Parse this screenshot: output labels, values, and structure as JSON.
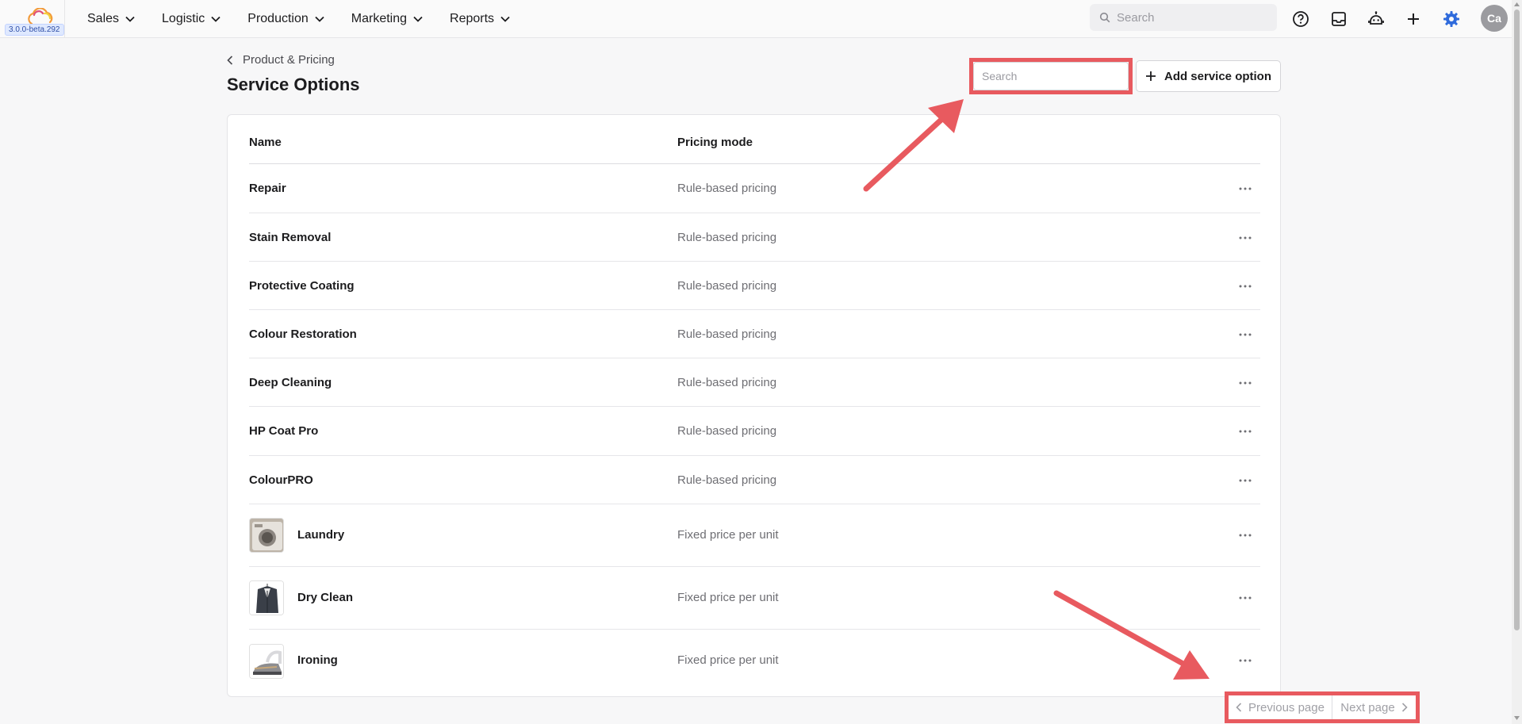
{
  "app": {
    "version": "3.0.0-beta.292",
    "accent_color": "#2f6bdc",
    "annotation_color": "#e85a5f"
  },
  "nav": {
    "items": [
      {
        "label": "Sales"
      },
      {
        "label": "Logistic"
      },
      {
        "label": "Production"
      },
      {
        "label": "Marketing"
      },
      {
        "label": "Reports"
      }
    ]
  },
  "topbar": {
    "search_placeholder": "Search",
    "avatar_initials": "Ca",
    "icons": [
      "help-icon",
      "inbox-icon",
      "assistant-bot-icon",
      "plus-icon",
      "settings-gear-icon"
    ]
  },
  "header": {
    "breadcrumb": "Product & Pricing",
    "title": "Service Options",
    "search_placeholder": "Search",
    "add_button": "Add service option"
  },
  "table": {
    "columns": {
      "name": "Name",
      "pricing_mode": "Pricing mode"
    },
    "rows": [
      {
        "name": "Repair",
        "pricing_mode": "Rule-based pricing"
      },
      {
        "name": "Stain Removal",
        "pricing_mode": "Rule-based pricing"
      },
      {
        "name": "Protective Coating",
        "pricing_mode": "Rule-based pricing"
      },
      {
        "name": "Colour Restoration",
        "pricing_mode": "Rule-based pricing"
      },
      {
        "name": "Deep Cleaning",
        "pricing_mode": "Rule-based pricing"
      },
      {
        "name": "HP Coat Pro",
        "pricing_mode": "Rule-based pricing"
      },
      {
        "name": "ColourPRO",
        "pricing_mode": "Rule-based pricing"
      },
      {
        "name": "Laundry",
        "pricing_mode": "Fixed price per unit",
        "thumbnail": "laundry-machine-image"
      },
      {
        "name": "Dry Clean",
        "pricing_mode": "Fixed price per unit",
        "thumbnail": "suit-jacket-image"
      },
      {
        "name": "Ironing",
        "pricing_mode": "Fixed price per unit",
        "thumbnail": "iron-image"
      }
    ]
  },
  "pagination": {
    "previous": "Previous page",
    "next": "Next page"
  }
}
